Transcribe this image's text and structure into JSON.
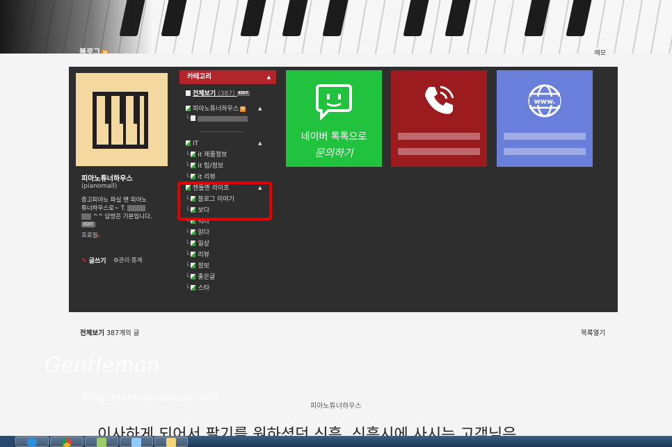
{
  "header": {
    "blog_label": "블로그",
    "new_badge": "N",
    "memo_label": "메모"
  },
  "profile": {
    "name": "피아노튜너하우스",
    "id": "(pianomall)",
    "desc_line1": "중고피아노 파실 땐 피아노",
    "desc_line2": "튜너하우스로~ T.",
    "desc_line3": "^^ 답방은 기본입니다.",
    "edit_tag": "EDIT",
    "profile_link": "프로필",
    "write_link": "글쓰기",
    "admin_link": "관리·통계"
  },
  "category": {
    "header": "카테고리",
    "items": [
      {
        "label": "전체보기",
        "count": "(387)",
        "badge": "EDIT"
      },
      {
        "label": "피아노튜너하우스",
        "badge": "N"
      },
      {
        "label": "IT"
      },
      {
        "label": "it 제품정보"
      },
      {
        "label": "it 팁/정보"
      },
      {
        "label": "it 리뷰"
      },
      {
        "label": "젠틀맨 라이프"
      },
      {
        "label": "블로그 이야기"
      },
      {
        "label": "보다"
      },
      {
        "label": "먹다"
      },
      {
        "label": "읽다"
      },
      {
        "label": "일상"
      },
      {
        "label": "리뷰"
      },
      {
        "label": "정보"
      },
      {
        "label": "좋은글"
      },
      {
        "label": "스타"
      }
    ]
  },
  "tiles": {
    "talk_line1": "네이버 톡톡으로",
    "talk_line2": "문의하기",
    "phone_icon": "phone-icon",
    "web_icon": "globe-www-icon",
    "chat_icon": "chat-bubble-icon"
  },
  "posts": {
    "all_label": "전체보기",
    "count_text": "387개의 글",
    "list_open": "목록열기"
  },
  "post": {
    "watermark_title": "Gentleman",
    "watermark_url": "blog.naver.com/pianomall",
    "site_name": "피아노튜너하우스",
    "title": "이사하게 되어서 팔기를 원하셨던 신흥, 신흥시에 사시는 고객님은"
  },
  "colors": {
    "panel": "#2e2e2e",
    "category_header": "#b4252b",
    "tile_green": "#21c23e",
    "tile_red": "#9b1b1f",
    "tile_blue": "#6a7fd9",
    "highlight": "#e40000"
  }
}
